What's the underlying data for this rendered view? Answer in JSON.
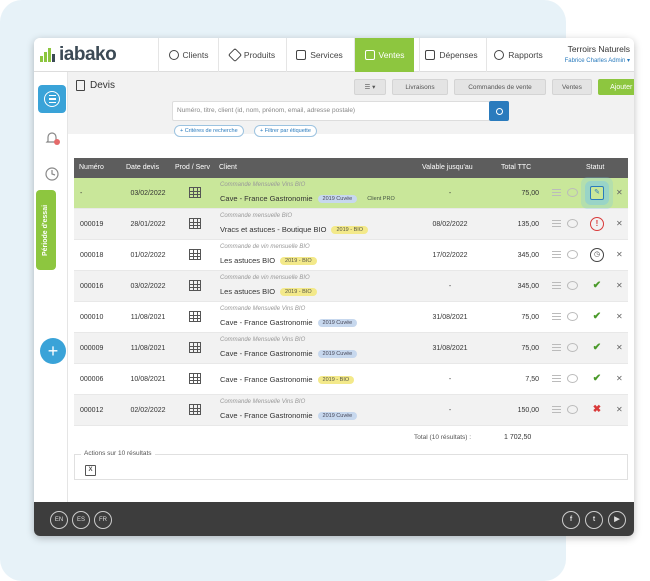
{
  "app": {
    "logo": "iabako"
  },
  "nav": {
    "items": [
      {
        "label": "Clients",
        "icon": "person-icon"
      },
      {
        "label": "Produits",
        "icon": "tag-icon"
      },
      {
        "label": "Services",
        "icon": "toolbox-icon"
      },
      {
        "label": "Ventes",
        "icon": "cart-icon",
        "active": true
      },
      {
        "label": "Dépenses",
        "icon": "calculator-icon"
      },
      {
        "label": "Rapports",
        "icon": "pie-chart-icon"
      }
    ],
    "company": "Terroirs Naturels",
    "user": "Fabrice Charles Admin"
  },
  "sidebar": {
    "trial_label": "Période d'essai",
    "add": "+"
  },
  "header": {
    "title": "Devis",
    "menu_btn": "☰ ▾",
    "livraisons": "Livraisons",
    "commandes": "Commandes de vente",
    "ventes": "Ventes",
    "ajouter": "Ajouter Devis",
    "search_placeholder": "Numéro, titre, client (id, nom, prénom, email, adresse postale)",
    "chip_criteria": "+ Critères de recherche",
    "chip_label": "+ Filtrer par étiquette"
  },
  "table": {
    "headers": {
      "numero": "Numéro",
      "date": "Date devis",
      "prod": "Prod / Serv",
      "client": "Client",
      "valid": "Valable jusqu'au",
      "total": "Total TTC",
      "statut": "Statut"
    },
    "rows": [
      {
        "num": "-",
        "date": "03/02/2022",
        "sub": "Commande Mensuelle Vins BIO",
        "client": "Cave - France Gastronomie",
        "badges": [
          {
            "t": "2019 Cuvée",
            "c": "b-blue"
          },
          {
            "t": "Client PRO",
            "c": "b-green"
          }
        ],
        "valid": "-",
        "total": "75,00",
        "status": "edit",
        "style": "sel"
      },
      {
        "num": "000019",
        "date": "28/01/2022",
        "sub": "Commande mensuelle BIO",
        "client": "Vracs et astuces - Boutique BIO",
        "badges": [
          {
            "t": "2019 - BIO",
            "c": "b-yellow"
          }
        ],
        "valid": "08/02/2022",
        "total": "135,00",
        "status": "warn",
        "style": "odd"
      },
      {
        "num": "000018",
        "date": "01/02/2022",
        "sub": "Commande de vin mensuelle BIO",
        "client": "Les astuces BIO",
        "badges": [
          {
            "t": "2019 - BIO",
            "c": "b-yellow"
          }
        ],
        "valid": "17/02/2022",
        "total": "345,00",
        "status": "clock",
        "style": ""
      },
      {
        "num": "000016",
        "date": "03/02/2022",
        "sub": "Commande de vin mensuelle BIO",
        "client": "Les astuces BIO",
        "badges": [
          {
            "t": "2019 - BIO",
            "c": "b-yellow"
          }
        ],
        "valid": "-",
        "total": "345,00",
        "status": "ok",
        "style": "odd"
      },
      {
        "num": "000010",
        "date": "11/08/2021",
        "sub": "Commande Mensuelle Vins BIO",
        "client": "Cave - France Gastronomie",
        "badges": [
          {
            "t": "2019 Cuvée",
            "c": "b-blue"
          }
        ],
        "valid": "31/08/2021",
        "total": "75,00",
        "status": "ok",
        "style": ""
      },
      {
        "num": "000009",
        "date": "11/08/2021",
        "sub": "Commande Mensuelle Vins BIO",
        "client": "Cave - France Gastronomie",
        "badges": [
          {
            "t": "2019 Cuvée",
            "c": "b-blue"
          }
        ],
        "valid": "31/08/2021",
        "total": "75,00",
        "status": "ok",
        "style": "odd"
      },
      {
        "num": "000006",
        "date": "10/08/2021",
        "sub": "",
        "client": "Cave - France Gastronomie",
        "badges": [
          {
            "t": "2019 - BIO",
            "c": "b-yellow"
          }
        ],
        "valid": "-",
        "total": "7,50",
        "status": "ok",
        "style": ""
      },
      {
        "num": "000012",
        "date": "02/02/2022",
        "sub": "Commande Mensuelle Vins BIO",
        "client": "Cave - France Gastronomie",
        "badges": [
          {
            "t": "2019 Cuvée",
            "c": "b-blue"
          }
        ],
        "valid": "-",
        "total": "150,00",
        "status": "no",
        "style": "odd"
      }
    ],
    "footer_label": "Total (10 résultats) :",
    "footer_total": "1 702,50"
  },
  "actions": {
    "label": "Actions sur 10 résultats",
    "xls": "X"
  },
  "footer": {
    "langs": [
      "EN",
      "ES",
      "FR"
    ],
    "social": [
      "f",
      "t",
      "▶"
    ]
  },
  "colors": {
    "accent_green": "#8dc63f",
    "accent_blue": "#3aa3d8",
    "link_blue": "#2a7bbd"
  }
}
